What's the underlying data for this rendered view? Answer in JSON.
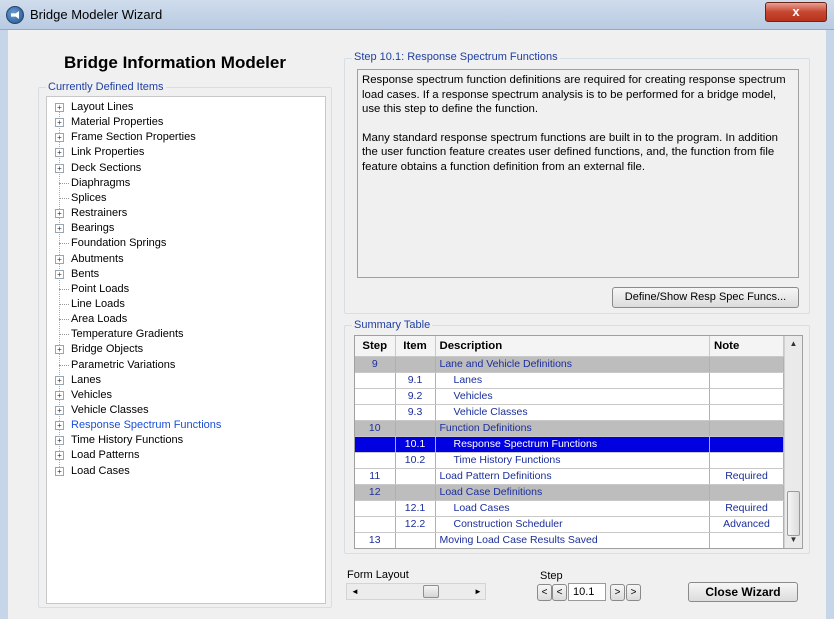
{
  "window": {
    "title": "Bridge Modeler Wizard",
    "close_glyph": "x"
  },
  "left": {
    "title": "Bridge Information Modeler",
    "tree_label": "Currently Defined Items",
    "expand_glyph": "+",
    "items": [
      {
        "label": "Layout Lines",
        "expandable": true
      },
      {
        "label": "Material Properties",
        "expandable": true
      },
      {
        "label": "Frame Section Properties",
        "expandable": true
      },
      {
        "label": "Link Properties",
        "expandable": true
      },
      {
        "label": "Deck Sections",
        "expandable": true
      },
      {
        "label": "Diaphragms",
        "expandable": false
      },
      {
        "label": "Splices",
        "expandable": false
      },
      {
        "label": "Restrainers",
        "expandable": true
      },
      {
        "label": "Bearings",
        "expandable": true
      },
      {
        "label": "Foundation Springs",
        "expandable": false
      },
      {
        "label": "Abutments",
        "expandable": true
      },
      {
        "label": "Bents",
        "expandable": true
      },
      {
        "label": "Point Loads",
        "expandable": false
      },
      {
        "label": "Line Loads",
        "expandable": false
      },
      {
        "label": "Area Loads",
        "expandable": false
      },
      {
        "label": "Temperature Gradients",
        "expandable": false
      },
      {
        "label": "Bridge Objects",
        "expandable": true
      },
      {
        "label": "Parametric Variations",
        "expandable": false
      },
      {
        "label": "Lanes",
        "expandable": true
      },
      {
        "label": "Vehicles",
        "expandable": true
      },
      {
        "label": "Vehicle Classes",
        "expandable": true
      },
      {
        "label": "Response Spectrum Functions",
        "expandable": true,
        "selected": true
      },
      {
        "label": "Time History Functions",
        "expandable": true
      },
      {
        "label": "Load Patterns",
        "expandable": true
      },
      {
        "label": "Load Cases",
        "expandable": true
      }
    ]
  },
  "step": {
    "header": "Step  10.1:  Response Spectrum Functions",
    "para1": "Response spectrum function definitions are required for creating response spectrum load cases. If a response spectrum analysis is to be performed for a bridge model, use this step to define the function.",
    "para2": "Many standard response spectrum functions are built in to the program. In addition the user function feature creates user defined functions, and, the function from file feature obtains a function definition from an external file.",
    "define_button": "Define/Show Resp Spec Funcs..."
  },
  "summary": {
    "label": "Summary Table",
    "headers": [
      "Step",
      "Item",
      "Description",
      "Note"
    ],
    "rows": [
      {
        "step": "9",
        "item": "",
        "desc": "Lane and Vehicle Definitions",
        "note": "",
        "type": "grp"
      },
      {
        "step": "",
        "item": "9.1",
        "desc": "Lanes",
        "note": "",
        "type": "sub"
      },
      {
        "step": "",
        "item": "9.2",
        "desc": "Vehicles",
        "note": "",
        "type": "sub"
      },
      {
        "step": "",
        "item": "9.3",
        "desc": "Vehicle Classes",
        "note": "",
        "type": "sub"
      },
      {
        "step": "10",
        "item": "",
        "desc": "Function Definitions",
        "note": "",
        "type": "grp"
      },
      {
        "step": "",
        "item": "10.1",
        "desc": "Response Spectrum Functions",
        "note": "",
        "type": "sel"
      },
      {
        "step": "",
        "item": "10.2",
        "desc": "Time History Functions",
        "note": "",
        "type": "sub"
      },
      {
        "step": "11",
        "item": "",
        "desc": "Load Pattern Definitions",
        "note": "Required",
        "type": "main"
      },
      {
        "step": "12",
        "item": "",
        "desc": "Load Case Definitions",
        "note": "",
        "type": "grp"
      },
      {
        "step": "",
        "item": "12.1",
        "desc": "Load Cases",
        "note": "Required",
        "type": "sub"
      },
      {
        "step": "",
        "item": "12.2",
        "desc": "Construction Scheduler",
        "note": "Advanced",
        "type": "sub"
      },
      {
        "step": "13",
        "item": "",
        "desc": "Moving Load Case Results Saved",
        "note": "",
        "type": "main"
      }
    ],
    "scroll_up": "▲",
    "scroll_down": "▼"
  },
  "bottom": {
    "form_layout_label": "Form Layout",
    "scroll_left": "◄",
    "scroll_right": "►",
    "step_label": "Step",
    "step_value": "10.1",
    "first_glyph": "<",
    "prev_glyph": "<",
    "next_glyph": ">",
    "last_glyph": ">",
    "close_button": "Close Wizard"
  }
}
